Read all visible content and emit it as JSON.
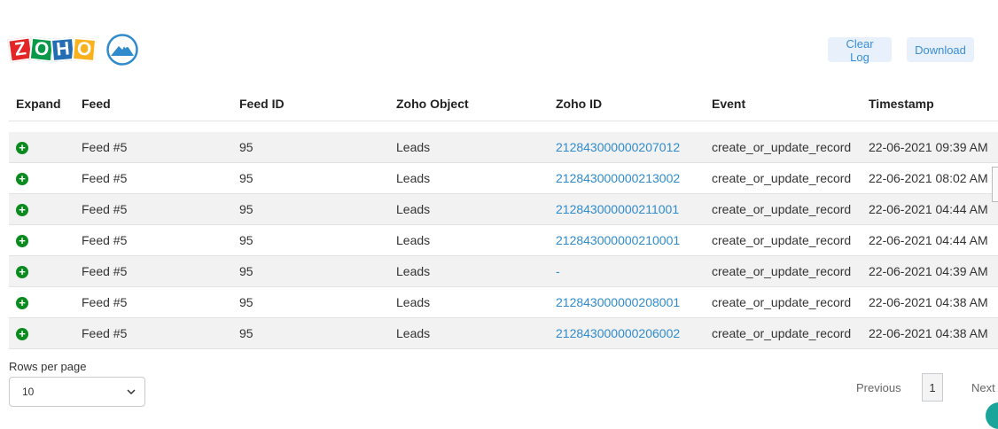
{
  "logo": {
    "letters": [
      "Z",
      "O",
      "H",
      "O"
    ],
    "icon": "mountain-icon"
  },
  "toolbar": {
    "clear_log": "Clear Log",
    "download": "Download"
  },
  "table": {
    "headers": [
      "Expand",
      "Feed",
      "Feed ID",
      "Zoho Object",
      "Zoho ID",
      "Event",
      "Timestamp"
    ],
    "rows": [
      {
        "icon": "plus-circle-icon",
        "feed": "Feed #5",
        "feed_id": "95",
        "object": "Leads",
        "zoho_id": "212843000000207012",
        "event": "create_or_update_record",
        "timestamp": "22-06-2021 09:39 AM"
      },
      {
        "icon": "plus-circle-icon",
        "feed": "Feed #5",
        "feed_id": "95",
        "object": "Leads",
        "zoho_id": "212843000000213002",
        "event": "create_or_update_record",
        "timestamp": "22-06-2021 08:02 AM"
      },
      {
        "icon": "plus-circle-icon",
        "feed": "Feed #5",
        "feed_id": "95",
        "object": "Leads",
        "zoho_id": "212843000000211001",
        "event": "create_or_update_record",
        "timestamp": "22-06-2021 04:44 AM"
      },
      {
        "icon": "plus-circle-icon",
        "feed": "Feed #5",
        "feed_id": "95",
        "object": "Leads",
        "zoho_id": "212843000000210001",
        "event": "create_or_update_record",
        "timestamp": "22-06-2021 04:44 AM"
      },
      {
        "icon": "plus-circle-icon",
        "feed": "Feed #5",
        "feed_id": "95",
        "object": "Leads",
        "zoho_id": "-",
        "event": "create_or_update_record",
        "timestamp": "22-06-2021 04:39 AM"
      },
      {
        "icon": "plus-circle-icon",
        "feed": "Feed #5",
        "feed_id": "95",
        "object": "Leads",
        "zoho_id": "212843000000208001",
        "event": "create_or_update_record",
        "timestamp": "22-06-2021 04:38 AM"
      },
      {
        "icon": "plus-circle-icon",
        "feed": "Feed #5",
        "feed_id": "95",
        "object": "Leads",
        "zoho_id": "212843000000206002",
        "event": "create_or_update_record",
        "timestamp": "22-06-2021 04:38 AM"
      }
    ]
  },
  "pagination": {
    "rows_label": "Rows per page",
    "rows_value": "10",
    "previous": "Previous",
    "page": "1",
    "next": "Next"
  },
  "colors": {
    "link": "#2f8bcc",
    "plus": "#0a8a1f",
    "button_bg": "#e8f1fb"
  }
}
